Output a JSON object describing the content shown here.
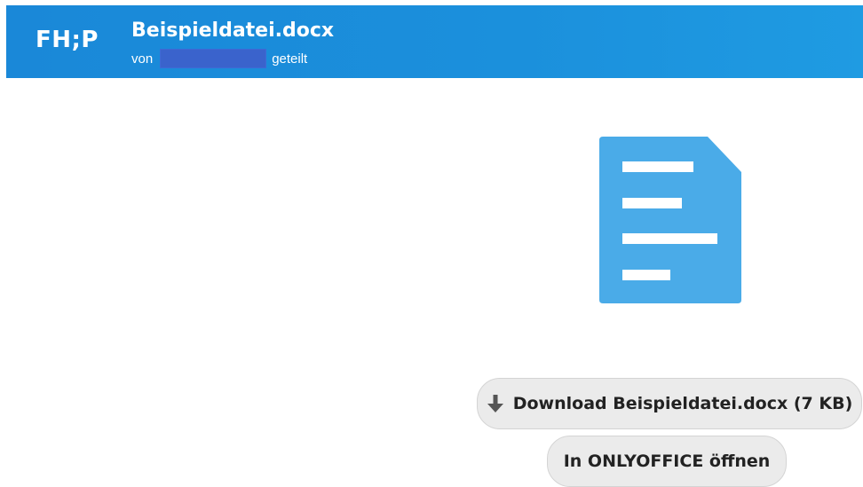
{
  "header": {
    "logo_text": "FH;P",
    "file_title": "Beispieldatei.docx",
    "shared_prefix": "von",
    "shared_suffix": "geteilt",
    "background_color": "#1d8fdb"
  },
  "preview": {
    "icon": "document-icon",
    "icon_color": "#4aabe8"
  },
  "actions": {
    "download_icon": "arrow-down-icon",
    "download_label": "Download Beispieldatei.docx (7 KB)",
    "open_label": "In ONLYOFFICE öffnen"
  }
}
